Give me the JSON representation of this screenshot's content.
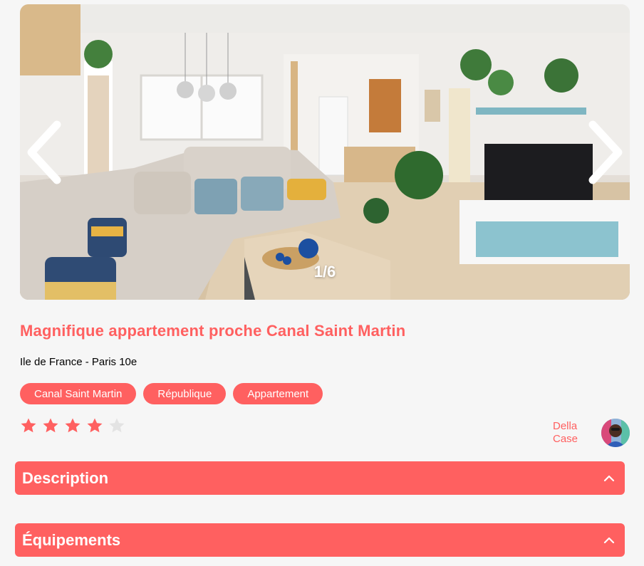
{
  "gallery": {
    "counter": "1/6",
    "prev_icon": "chevron-left-icon",
    "next_icon": "chevron-right-icon"
  },
  "listing": {
    "title": "Magnifique appartement proche Canal Saint Martin",
    "location": "Ile de France - Paris 10e",
    "tags": [
      "Canal Saint Martin",
      "République",
      "Appartement"
    ],
    "rating": 4,
    "rating_max": 5
  },
  "host": {
    "name": "Della Case"
  },
  "sections": {
    "description_label": "Description",
    "equipments_label": "Équipements"
  },
  "colors": {
    "accent": "#ff6060",
    "star_inactive": "#e3e3e3",
    "background": "#f6f6f6"
  }
}
